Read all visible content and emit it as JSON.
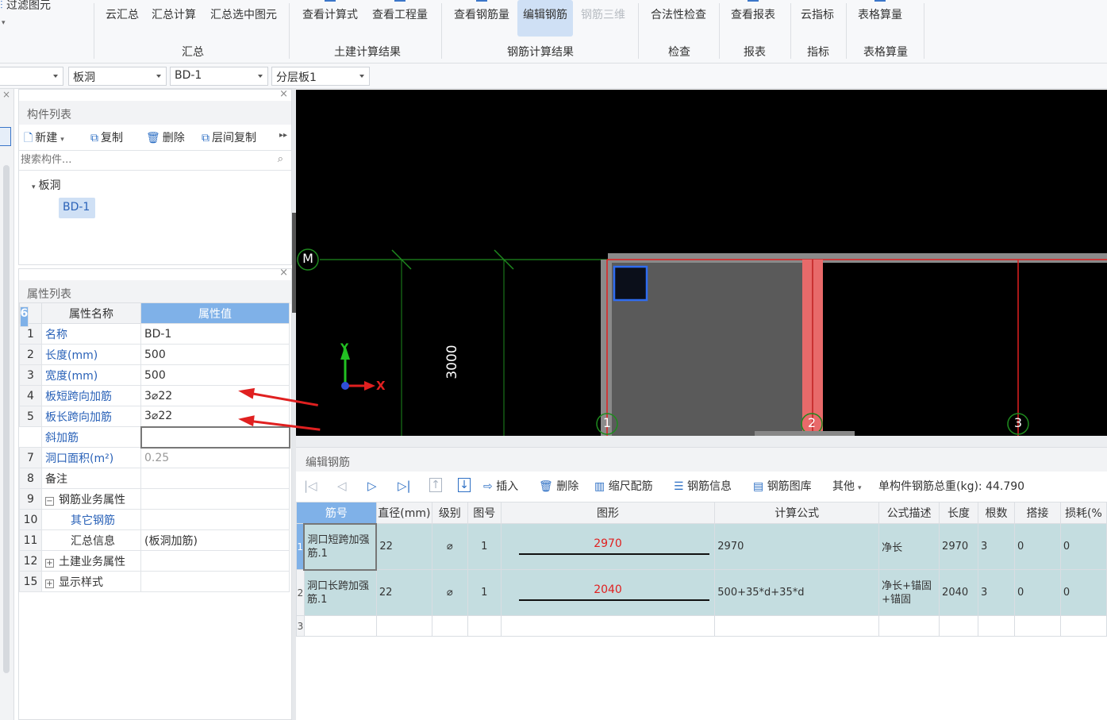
{
  "ribbon": {
    "top_left": "过滤图元",
    "buttons": [
      {
        "label": "云汇总",
        "state": "normal"
      },
      {
        "label": "汇总计算",
        "state": "normal"
      },
      {
        "label": "汇总选中图元",
        "state": "normal"
      },
      {
        "label": "查看计算式",
        "state": "normal"
      },
      {
        "label": "查看工程量",
        "state": "normal"
      },
      {
        "label": "查看钢筋量",
        "state": "normal"
      },
      {
        "label": "编辑钢筋",
        "state": "active"
      },
      {
        "label": "钢筋三维",
        "state": "disabled"
      },
      {
        "label": "合法性检查",
        "state": "normal"
      },
      {
        "label": "查看报表",
        "state": "normal"
      },
      {
        "label": "云指标",
        "state": "normal"
      },
      {
        "label": "表格算量",
        "state": "normal"
      }
    ],
    "groups": [
      "汇总",
      "土建计算结果",
      "钢筋计算结果",
      "检查",
      "报表",
      "指标",
      "表格算量"
    ]
  },
  "selectors": {
    "category": "板洞",
    "component": "BD-1",
    "layer": "分层板1"
  },
  "component_list": {
    "title": "构件列表",
    "toolbar": {
      "new": "新建",
      "copy": "复制",
      "delete": "删除",
      "floor_copy": "层间复制"
    },
    "search_placeholder": "搜索构件...",
    "tree": {
      "group": "板洞",
      "item": "BD-1"
    }
  },
  "property_list": {
    "title": "属性列表",
    "header": {
      "name": "属性名称",
      "value": "属性值"
    },
    "rows": [
      {
        "num": "1",
        "name": "名称",
        "value": "BD-1"
      },
      {
        "num": "2",
        "name": "长度(mm)",
        "value": "500"
      },
      {
        "num": "3",
        "name": "宽度(mm)",
        "value": "500"
      },
      {
        "num": "4",
        "name": "板短跨向加筋",
        "value": "3⌀22"
      },
      {
        "num": "5",
        "name": "板长跨向加筋",
        "value": "3⌀22"
      },
      {
        "num": "6",
        "name": "斜加筋",
        "value": ""
      },
      {
        "num": "7",
        "name": "洞口面积(m²)",
        "value": "0.25"
      },
      {
        "num": "8",
        "name": "备注",
        "value": ""
      },
      {
        "num": "9",
        "name": "钢筋业务属性",
        "value": ""
      },
      {
        "num": "10",
        "name": "其它钢筋",
        "value": ""
      },
      {
        "num": "11",
        "name": "汇总信息",
        "value": "(板洞加筋)"
      },
      {
        "num": "12",
        "name": "土建业务属性",
        "value": ""
      },
      {
        "num": "15",
        "name": "显示样式",
        "value": ""
      }
    ]
  },
  "canvas": {
    "axis_labels": {
      "m": "M",
      "one": "1",
      "two": "2",
      "three": "3"
    },
    "dimension": "3000",
    "coord_x": "X",
    "coord_y": "Y"
  },
  "edit_rebar": {
    "title": "编辑钢筋",
    "toolbar": {
      "insert": "插入",
      "delete": "删除",
      "scale": "缩尺配筋",
      "info": "钢筋信息",
      "library": "钢筋图库",
      "other": "其他",
      "total": "单构件钢筋总重(kg): 44.790"
    },
    "columns": [
      "筋号",
      "直径(mm)",
      "级别",
      "图号",
      "图形",
      "计算公式",
      "公式描述",
      "长度",
      "根数",
      "搭接",
      "损耗(%"
    ],
    "rows": [
      {
        "row": "1",
        "name": "洞口短跨加强筋.1",
        "diameter": "22",
        "grade": "⌀",
        "fig": "1",
        "shape_value": "2970",
        "formula": "2970",
        "desc": "净长",
        "length": "2970",
        "count": "3",
        "lap": "0",
        "loss": "0"
      },
      {
        "row": "2",
        "name": "洞口长跨加强筋.1",
        "diameter": "22",
        "grade": "⌀",
        "fig": "1",
        "shape_value": "2040",
        "formula": "500+35*d+35*d",
        "desc": "净长+锚固+锚固",
        "length": "2040",
        "count": "3",
        "lap": "0",
        "loss": "0"
      },
      {
        "row": "3"
      }
    ]
  },
  "colors": {
    "accent": "#7fb1e8",
    "link": "#2a62b8",
    "axis_green": "#1e8a1e",
    "annotation_red": "#e02020",
    "row_highlight": "#c4dde0"
  }
}
